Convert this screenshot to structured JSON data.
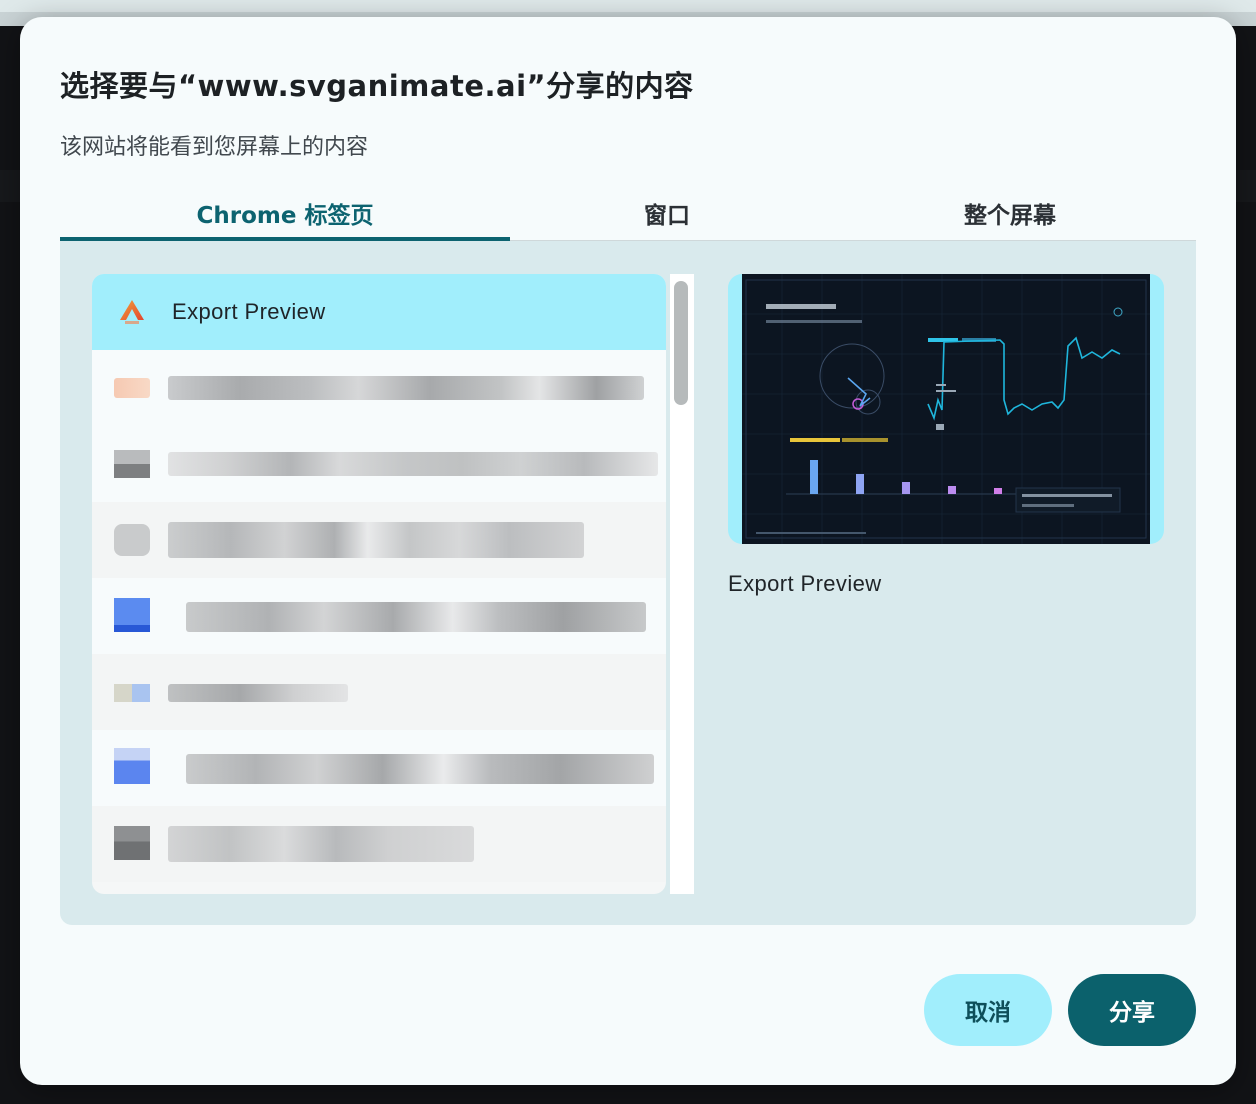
{
  "dialog": {
    "title": "选择要与“www.svganimate.ai”分享的内容",
    "subtitle": "该网站将能看到您屏幕上的内容"
  },
  "tabs": [
    {
      "label": "Chrome 标签页",
      "active": true
    },
    {
      "label": "窗口",
      "active": false
    },
    {
      "label": "整个屏幕",
      "active": false
    }
  ],
  "tab_list": {
    "items": [
      {
        "label": "Export Preview",
        "icon": "app-logo-icon",
        "selected": true
      },
      {
        "label": "",
        "icon": "blurred-favicon-icon",
        "selected": false
      },
      {
        "label": "",
        "icon": "blurred-favicon-icon",
        "selected": false
      },
      {
        "label": "",
        "icon": "blurred-favicon-icon",
        "selected": false
      },
      {
        "label": "",
        "icon": "blurred-favicon-icon",
        "selected": false
      },
      {
        "label": "",
        "icon": "blurred-favicon-icon",
        "selected": false
      },
      {
        "label": "",
        "icon": "blurred-favicon-icon",
        "selected": false
      },
      {
        "label": "",
        "icon": "blurred-favicon-icon",
        "selected": false
      }
    ]
  },
  "preview": {
    "label": "Export Preview"
  },
  "buttons": {
    "cancel": "取消",
    "share": "分享"
  },
  "colors": {
    "accent": "#0b616c",
    "selected_bg": "#a1eefc",
    "panel_bg": "#d9eaed",
    "dialog_bg": "#f6fbfc"
  }
}
